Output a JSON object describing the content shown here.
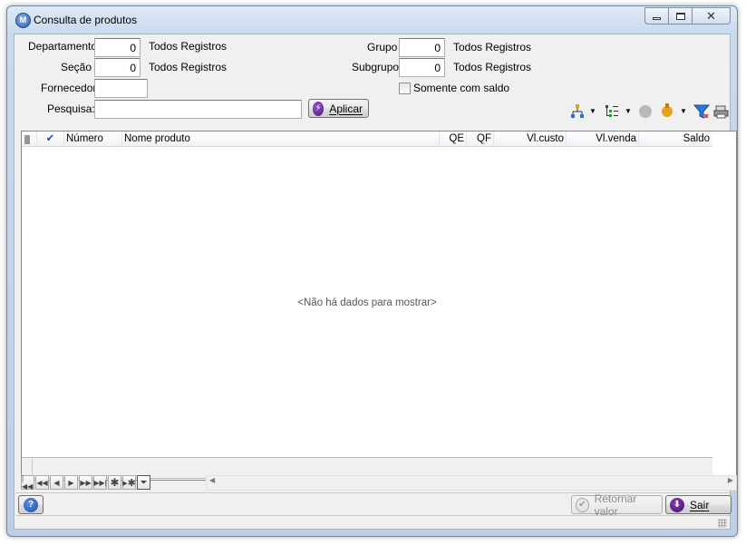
{
  "window": {
    "title": "Consulta de produtos",
    "app_icon_glyph": "M"
  },
  "filters": {
    "departamento": {
      "label": "Departamento",
      "value": "0",
      "desc": "Todos Registros"
    },
    "secao": {
      "label": "Seção",
      "value": "0",
      "desc": "Todos Registros"
    },
    "fornecedor": {
      "label": "Fornecedor",
      "value": ""
    },
    "grupo": {
      "label": "Grupo",
      "value": "0",
      "desc": "Todos Registros"
    },
    "subgrupo": {
      "label": "Subgrupo",
      "value": "0",
      "desc": "Todos Registros"
    },
    "somente_saldo": {
      "label": "Somente com saldo",
      "checked": false
    },
    "pesquisa": {
      "label": "Pesquisa:",
      "value": ""
    },
    "aplicar_label": "Aplicar"
  },
  "toolbar_icons": [
    "hierarchy-icon",
    "list-tree-icon",
    "circle-icon",
    "bulb-icon",
    "filter-icon",
    "printer-icon"
  ],
  "grid": {
    "columns": [
      "Número",
      "Nome produto",
      "QE",
      "QF",
      "Vl.custo",
      "Vl.venda",
      "Saldo"
    ],
    "empty_message": "<Não há dados para mostrar>"
  },
  "buttons": {
    "retornar_valor": "Retornar valor",
    "sair": "Sair"
  },
  "colors": {
    "title_bg": "#c9daee",
    "accent": "#2b5fa8"
  }
}
